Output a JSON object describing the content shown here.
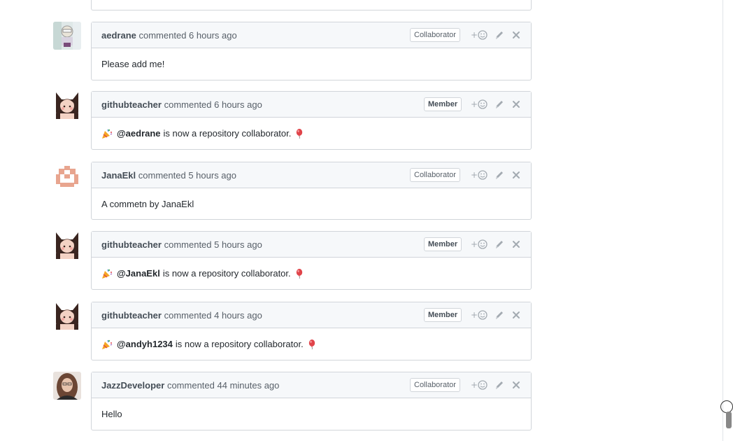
{
  "comments": [
    {
      "author": "aedrane",
      "action": "commented",
      "time": "6 hours ago",
      "badge": "Collaborator",
      "body_text": "Please add me!"
    },
    {
      "author": "githubteacher",
      "action": "commented",
      "time": "6 hours ago",
      "badge": "Member",
      "mention": "@aedrane",
      "body_text": "is now a repository collaborator."
    },
    {
      "author": "JanaEkl",
      "action": "commented",
      "time": "5 hours ago",
      "badge": "Collaborator",
      "body_text": "A commetn by JanaEkl"
    },
    {
      "author": "githubteacher",
      "action": "commented",
      "time": "5 hours ago",
      "badge": "Member",
      "mention": "@JanaEkl",
      "body_text": "is now a repository collaborator."
    },
    {
      "author": "githubteacher",
      "action": "commented",
      "time": "4 hours ago",
      "badge": "Member",
      "mention": "@andyh1234",
      "body_text": "is now a repository collaborator."
    },
    {
      "author": "JazzDeveloper",
      "action": "commented",
      "time": "44 minutes ago",
      "badge": "Collaborator",
      "body_text": "Hello"
    }
  ],
  "icons": {
    "reaction": "add-reaction-icon",
    "edit": "pencil-icon",
    "delete": "close-icon",
    "party": "party-popper-icon",
    "balloon": "balloon-icon"
  },
  "colors": {
    "border": "#d1d5da",
    "header_bg": "#f6f8fa",
    "meta_text": "#586069",
    "balloon": "#e0444a"
  }
}
